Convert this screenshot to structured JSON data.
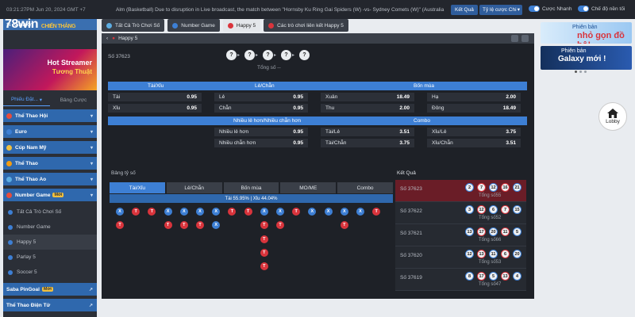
{
  "topbar": {
    "datetime": "03:21:27PM Jun 20, 2024 GMT +7",
    "ticker": "Alm (Basketball) Due to disruption in Live broadcast, the match between \"Hornsby Ku Ring Gai Spiders (W) -vs- Sydney Comets (W)\" (Australia",
    "result_button": "Kết Quả",
    "odds_type": "Tỷ lệ cược Chi",
    "toggle_quick": "Cược Nhanh",
    "toggle_fullscreen": "Chế độ nền tối"
  },
  "sidebar": {
    "logo": "78win",
    "logo_sub": "CHIẾN THẮNG",
    "galaxy": "Galaxy",
    "banner_line1": "Hot Streamer",
    "banner_line2": "Tương Thuật",
    "tab_betslip": "Phiếu Đặt...",
    "tab_betlist": "Bảng Cược",
    "items": [
      {
        "label": "Thể Thao Hội",
        "color": "#e74c3c"
      },
      {
        "label": "Euro",
        "color": "#3d7fd4"
      },
      {
        "label": "Cúp Nam Mỹ",
        "color": "#f0c040"
      },
      {
        "label": "Thể Thao",
        "color": "#f39c12"
      },
      {
        "label": "Thể Thao Ao",
        "color": "#5dade2"
      },
      {
        "label": "Number Game",
        "badge": "Mới",
        "color": "#e74c3c"
      }
    ],
    "subitems": [
      "Tất Cả Trò Chơi Số",
      "Number Game",
      "Happy 5",
      "Parlay 5",
      "Soccer 5"
    ],
    "bottom_items": [
      {
        "label": "Saba PinGoal",
        "badge": "Mới"
      },
      {
        "label": "Thể Thao Điện Tử"
      }
    ]
  },
  "game_tabs": [
    {
      "label": "Tất Cả Trò Chơi Số",
      "active": false
    },
    {
      "label": "Number Game",
      "active": false
    },
    {
      "label": "Happy 5",
      "active": true
    },
    {
      "label": "Các trò chơi liên kết Happy 5",
      "active": false
    }
  ],
  "panel": {
    "title": "Happy 5",
    "draw_id": "Số 37623",
    "draw_total": "Tổng số --",
    "pending_symbol": "?"
  },
  "odds": {
    "headers": {
      "taixiu": "Tài/Xỉu",
      "lechan": "Lẻ/Chẵn",
      "bonmua": "Bốn mùa",
      "nhieu": "Nhiều lẻ hơn/Nhiều chẵn hơn",
      "combo": "Combo"
    },
    "rows1": [
      [
        {
          "n": "Tài",
          "v": "0.95"
        },
        {
          "n": "Lẻ",
          "v": "0.95"
        },
        {
          "n": "Xuân",
          "v": "18.49"
        },
        {
          "n": "Hạ",
          "v": "2.00"
        }
      ],
      [
        {
          "n": "Xỉu",
          "v": "0.95"
        },
        {
          "n": "Chẵn",
          "v": "0.95"
        },
        {
          "n": "Thu",
          "v": "2.00"
        },
        {
          "n": "Đông",
          "v": "18.49"
        }
      ]
    ],
    "rows2": [
      [
        {
          "n": "Nhiều lẻ hơn",
          "v": "0.95"
        },
        {
          "n": "Tài/Lẻ",
          "v": "3.51"
        },
        {
          "n": "Xỉu/Lẻ",
          "v": "3.75"
        }
      ],
      [
        {
          "n": "Nhiều chẵn hơn",
          "v": "0.95"
        },
        {
          "n": "Tài/Chẵn",
          "v": "3.75"
        },
        {
          "n": "Xỉu/Chẵn",
          "v": "3.51"
        }
      ]
    ]
  },
  "stats": {
    "title": "Bảng tỷ số",
    "tabs": [
      "Tài/Xỉu",
      "Lẻ/Chẵn",
      "Bốn mùa",
      "MO/ME",
      "Combo"
    ],
    "ratio": "Tài 55.95% | Xỉu 44.04%",
    "columns": [
      [
        "X",
        "T"
      ],
      [
        "T"
      ],
      [
        "T"
      ],
      [
        "X",
        "T"
      ],
      [
        "X",
        "T"
      ],
      [
        "X",
        "T"
      ],
      [
        "X",
        "X"
      ],
      [
        "T"
      ],
      [
        "T"
      ],
      [
        "X",
        "T",
        "T",
        "T",
        "T"
      ],
      [
        "X",
        "T"
      ],
      [
        "T"
      ],
      [
        "X"
      ],
      [
        "X"
      ],
      [
        "X",
        "T"
      ],
      [
        "X"
      ],
      [
        "T"
      ]
    ]
  },
  "results": {
    "title": "Kết Quả",
    "rows": [
      {
        "id": "Số 37623",
        "balls": [
          "2",
          "7",
          "12",
          "16",
          "21"
        ],
        "total": "Tổng số55",
        "hl": true
      },
      {
        "id": "Số 37622",
        "balls": [
          "3",
          "12",
          "6",
          "7",
          "15"
        ],
        "total": "Tổng số52",
        "hl": false
      },
      {
        "id": "Số 37621",
        "balls": [
          "13",
          "17",
          "20",
          "11",
          "5"
        ],
        "total": "Tổng số66",
        "hl": false
      },
      {
        "id": "Số 37620",
        "balls": [
          "12",
          "13",
          "11",
          "6",
          "20"
        ],
        "total": "Tổng số53",
        "hl": false
      },
      {
        "id": "Số 37619",
        "balls": [
          "8",
          "17",
          "5",
          "13",
          "4"
        ],
        "total": "Tổng số47",
        "hl": false
      }
    ]
  },
  "right": {
    "promo1_line1": "Phiên bản",
    "promo1_line2": "nhỏ gọn đồ bộ!",
    "promo2_line1": "Phiên bản",
    "promo2_line2": "Galaxy mới !",
    "lobby": "Lobby"
  }
}
